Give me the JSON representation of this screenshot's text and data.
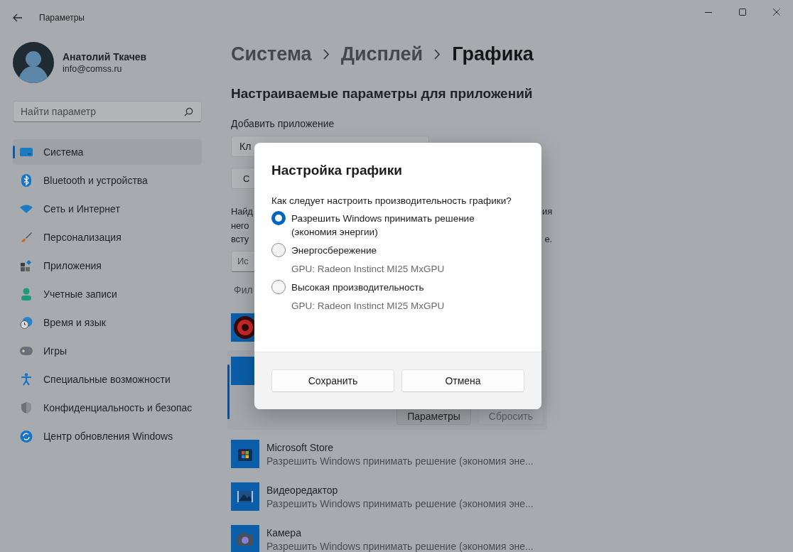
{
  "window": {
    "title": "Параметры"
  },
  "profile": {
    "name": "Анатолий Ткачев",
    "email": "info@comss.ru"
  },
  "search": {
    "placeholder": "Найти параметр"
  },
  "sidebar": {
    "items": [
      {
        "label": "Система",
        "selected": true
      },
      {
        "label": "Bluetooth и устройства",
        "selected": false
      },
      {
        "label": "Сеть и Интернет",
        "selected": false
      },
      {
        "label": "Персонализация",
        "selected": false
      },
      {
        "label": "Приложения",
        "selected": false
      },
      {
        "label": "Учетные записи",
        "selected": false
      },
      {
        "label": "Время и язык",
        "selected": false
      },
      {
        "label": "Игры",
        "selected": false
      },
      {
        "label": "Специальные возможности",
        "selected": false
      },
      {
        "label": "Конфиденциальность и безопас",
        "selected": false
      },
      {
        "label": "Центр обновления Windows",
        "selected": false
      }
    ]
  },
  "breadcrumb": [
    {
      "label": "Система",
      "current": false
    },
    {
      "label": "Дисплей",
      "current": false
    },
    {
      "label": "Графика",
      "current": true
    }
  ],
  "section_title": "Настраиваемые параметры для приложений",
  "add_app": {
    "label": "Добавить приложение",
    "dropdown_value": "Кл",
    "button_label": "С"
  },
  "description": [
    {
      "left": "Найд",
      "right": "ия"
    },
    {
      "left": "него"
    },
    {
      "left": "всту",
      "right": "е."
    }
  ],
  "app_search": {
    "placeholder": "Ис"
  },
  "filter_label": "Фил",
  "apps": [
    {
      "kind": "hidden"
    },
    {
      "kind": "expanded",
      "buttons": [
        {
          "label": "Параметры",
          "disabled": false
        },
        {
          "label": "Сбросить",
          "disabled": true
        }
      ]
    },
    {
      "kind": "store",
      "name": "Microsoft Store",
      "subtitle": "Разрешить Windows принимать решение (экономия эне..."
    },
    {
      "kind": "video",
      "name": "Видеоредактор",
      "subtitle": "Разрешить Windows принимать решение (экономия эне..."
    },
    {
      "kind": "camera",
      "name": "Камера",
      "subtitle": "Разрешить Windows принимать решение (экономия эне..."
    }
  ],
  "dialog": {
    "title": "Настройка графики",
    "question": "Как следует настроить производительность графики?",
    "options": [
      {
        "label": "Разрешить Windows принимать решение (экономия энергии)",
        "selected": true
      },
      {
        "label": "Энергосбережение",
        "detail": "GPU: Radeon Instinct MI25 MxGPU",
        "selected": false
      },
      {
        "label": "Высокая производительность",
        "detail": "GPU: Radeon Instinct MI25 MxGPU",
        "selected": false
      }
    ],
    "buttons": [
      "Сохранить",
      "Отмена"
    ]
  }
}
